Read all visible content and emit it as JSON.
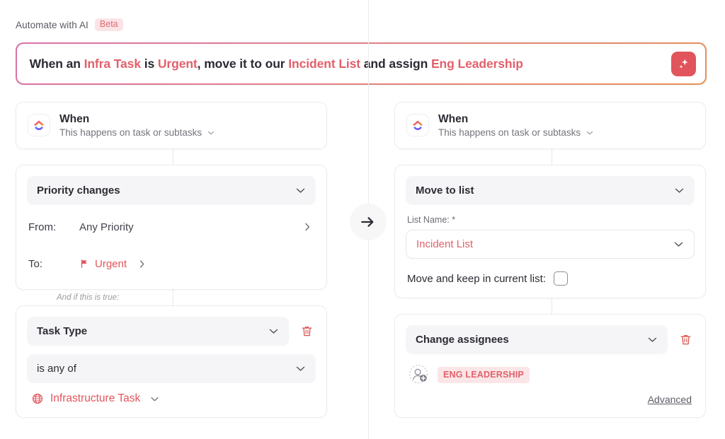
{
  "header": {
    "title": "Automate with AI",
    "badge": "Beta"
  },
  "prompt": {
    "segments": [
      {
        "text": "When an ",
        "highlight": false
      },
      {
        "text": "Infra Task",
        "highlight": true
      },
      {
        "text": " is ",
        "highlight": false
      },
      {
        "text": "Urgent",
        "highlight": true
      },
      {
        "text": ", move it to our ",
        "highlight": false
      },
      {
        "text": "Incident List",
        "highlight": true
      },
      {
        "text": " and assign ",
        "highlight": false
      },
      {
        "text": "Eng Leadership",
        "highlight": true
      }
    ],
    "plain_text": "When an Infra Task is Urgent, move it to our Incident List and assign Eng Leadership",
    "generate_button_icon": "sparkle-icon",
    "accent_color": "#e2545c"
  },
  "flow": {
    "arrow_icon": "arrow-right-icon"
  },
  "left": {
    "when_card": {
      "icon": "clickup-logo-icon",
      "title": "When",
      "subtitle": "This happens on task or subtasks",
      "chevron": "chevron-down-icon"
    },
    "trigger_card": {
      "select_value": "Priority changes",
      "rows": [
        {
          "key": "From:",
          "value": "Any Priority",
          "flag": false,
          "chevron": "chevron-right-icon"
        },
        {
          "key": "To:",
          "value": "Urgent",
          "flag": true,
          "chevron": "chevron-right-icon"
        }
      ]
    },
    "condition_label": "And if this is true:",
    "condition_card": {
      "field_select": "Task Type",
      "operator_select": "is any of",
      "value_icon": "globe-icon",
      "value_text": "Infrastructure Task",
      "value_chevron": "chevron-down-icon",
      "delete_icon": "trash-icon"
    }
  },
  "right": {
    "when_card": {
      "icon": "clickup-logo-icon",
      "title": "When",
      "subtitle": "This happens on task or subtasks",
      "chevron": "chevron-down-icon"
    },
    "move_card": {
      "action_select": "Move to list",
      "field_label": "List Name: *",
      "list_value": "Incident List",
      "checkbox_label": "Move and keep in current list:",
      "checkbox_checked": false
    },
    "assignee_card": {
      "action_select": "Change assignees",
      "avatar_icon": "add-user-icon",
      "assignee_chip": "ENG LEADERSHIP",
      "advanced_link": "Advanced",
      "delete_icon": "trash-icon"
    }
  }
}
